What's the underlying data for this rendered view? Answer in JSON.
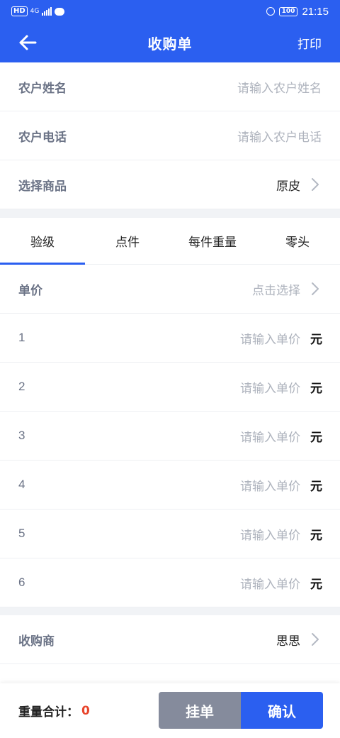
{
  "status_bar": {
    "hd": "HD",
    "network": "4G",
    "battery": "100",
    "time": "21:15"
  },
  "nav": {
    "title": "收购单",
    "action": "打印"
  },
  "farmer": {
    "name_label": "农户姓名",
    "name_placeholder": "请输入农户姓名",
    "phone_label": "农户电话",
    "phone_placeholder": "请输入农户电话",
    "product_label": "选择商品",
    "product_value": "原皮"
  },
  "tabs": [
    "验级",
    "点件",
    "每件重量",
    "零头"
  ],
  "grade": {
    "price_label": "单价",
    "price_select": "点击选择",
    "rows": [
      {
        "index": "1",
        "placeholder": "请输入单价",
        "unit": "元"
      },
      {
        "index": "2",
        "placeholder": "请输入单价",
        "unit": "元"
      },
      {
        "index": "3",
        "placeholder": "请输入单价",
        "unit": "元"
      },
      {
        "index": "4",
        "placeholder": "请输入单价",
        "unit": "元"
      },
      {
        "index": "5",
        "placeholder": "请输入单价",
        "unit": "元"
      },
      {
        "index": "6",
        "placeholder": "请输入单价",
        "unit": "元"
      }
    ]
  },
  "buyer": {
    "label": "收购商",
    "value": "思思"
  },
  "footer": {
    "total_label": "重量合计：",
    "total_value": "0",
    "hang_label": "挂单",
    "confirm_label": "确认"
  },
  "colors": {
    "primary": "#2b5ff0",
    "secondary_button": "#858b9c",
    "total_value": "#e8452c"
  }
}
